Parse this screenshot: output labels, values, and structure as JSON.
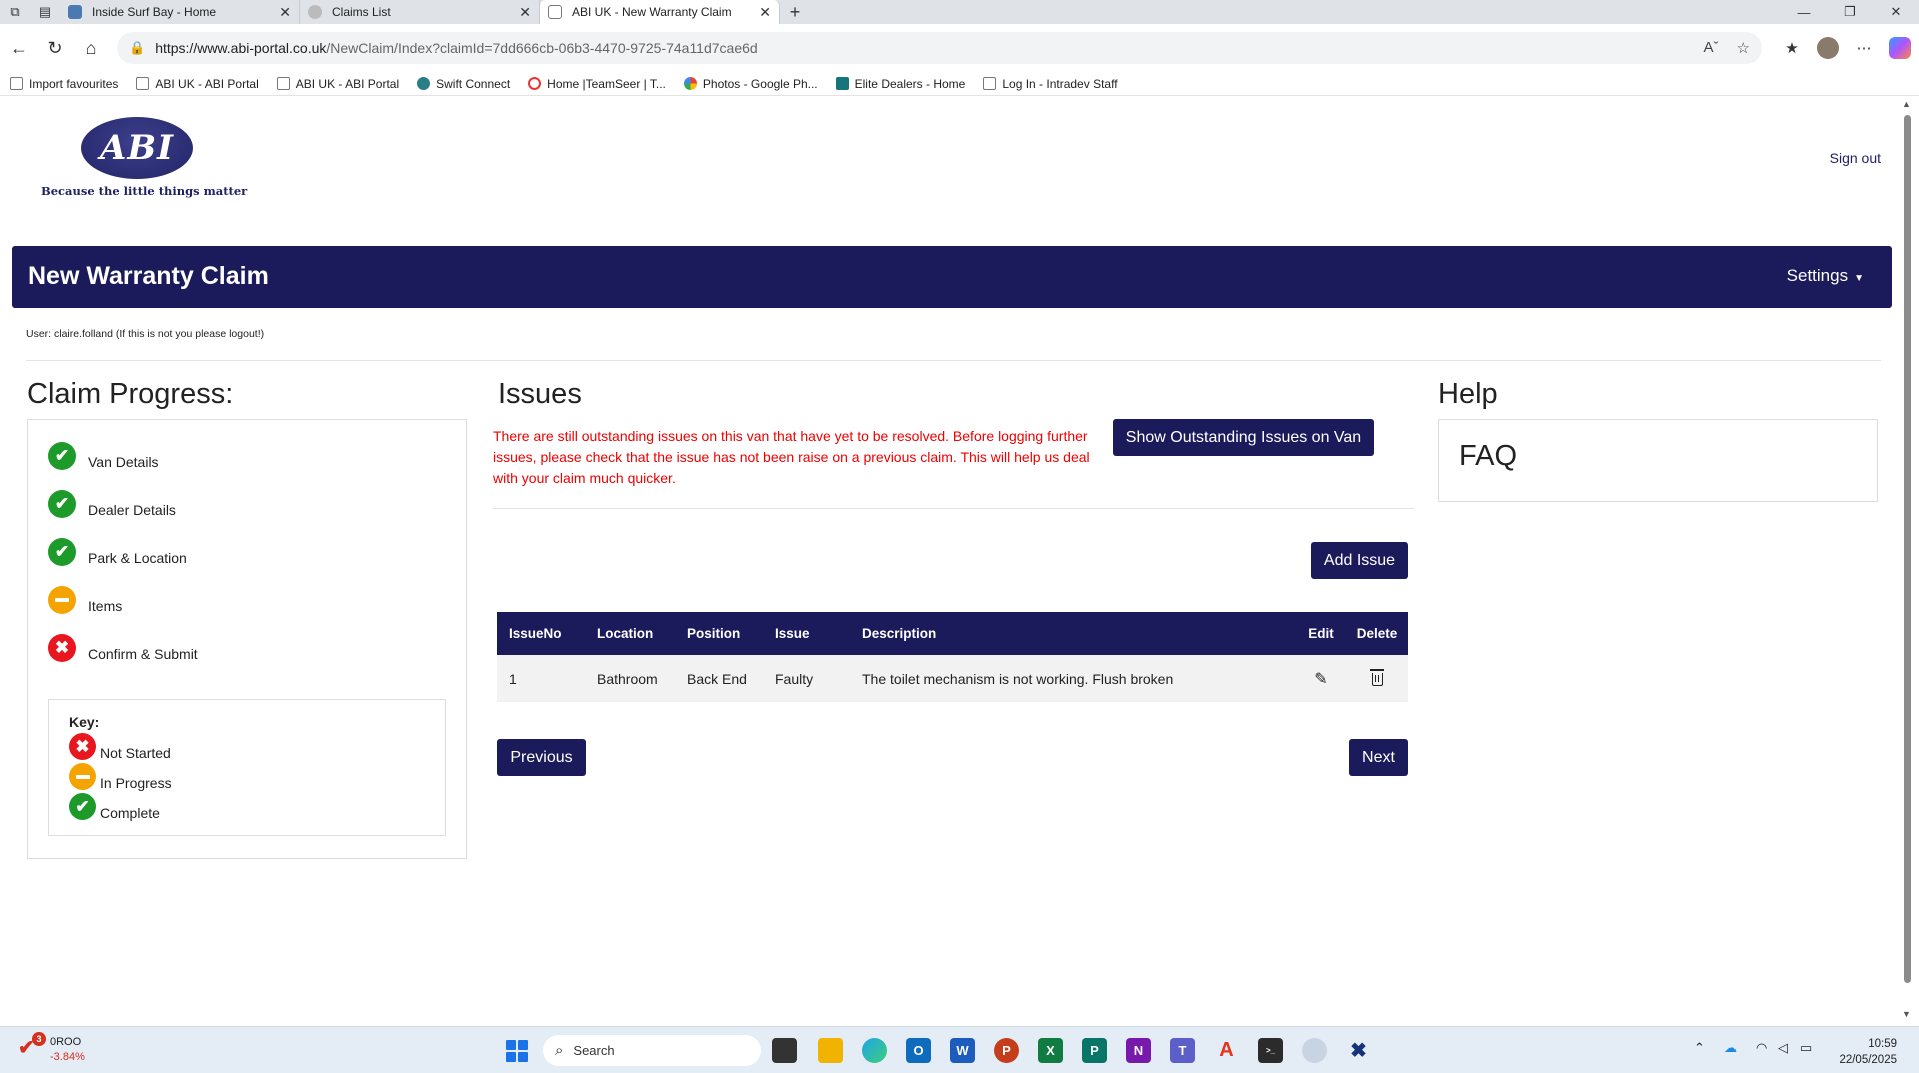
{
  "browser": {
    "tabs": [
      {
        "title": "Inside Surf Bay - Home",
        "active": false
      },
      {
        "title": "Claims List",
        "active": false
      },
      {
        "title": "ABI UK - New Warranty Claim",
        "active": true
      }
    ],
    "url_host": "https://www.abi-portal.co.uk",
    "url_path": "/NewClaim/Index?claimId=7dd666cb-06b3-4470-9725-74a11d7cae6d",
    "bookmarks": [
      "Import favourites",
      "ABI UK - ABI Portal",
      "ABI UK - ABI Portal",
      "Swift Connect",
      "Home |TeamSeer | T...",
      "Photos - Google Ph...",
      "Elite Dealers - Home",
      "Log In - Intradev Staff"
    ]
  },
  "header": {
    "logo_text": "ABI",
    "tagline": "Because the little things matter",
    "sign_out": "Sign out"
  },
  "topbar": {
    "title": "New Warranty Claim",
    "settings": "Settings"
  },
  "user_line": "User: claire.folland (If this is not you please logout!)",
  "progress": {
    "heading": "Claim Progress:",
    "steps": [
      {
        "label": "Van Details",
        "status": "complete"
      },
      {
        "label": "Dealer Details",
        "status": "complete"
      },
      {
        "label": "Park & Location",
        "status": "complete"
      },
      {
        "label": "Items",
        "status": "in-progress"
      },
      {
        "label": "Confirm & Submit",
        "status": "not-started"
      }
    ],
    "key": {
      "title": "Key:",
      "items": [
        {
          "label": "Not Started",
          "status": "not-started"
        },
        {
          "label": "In Progress",
          "status": "in-progress"
        },
        {
          "label": "Complete",
          "status": "complete"
        }
      ]
    }
  },
  "issues": {
    "heading": "Issues",
    "warning": "There are still outstanding issues on this van that have yet to be resolved. Before logging further issues, please check that the issue has not been raise on a previous claim. This will help us deal with your claim much quicker.",
    "show_outstanding_label": "Show Outstanding Issues on Van",
    "add_issue_label": "Add Issue",
    "columns": [
      "IssueNo",
      "Location",
      "Position",
      "Issue",
      "Description",
      "Edit",
      "Delete"
    ],
    "rows": [
      {
        "issue_no": "1",
        "location": "Bathroom",
        "position": "Back End",
        "issue": "Faulty",
        "description": "The toilet mechanism is not working. Flush broken"
      }
    ],
    "previous_label": "Previous",
    "next_label": "Next"
  },
  "help": {
    "heading": "Help",
    "faq": "FAQ"
  },
  "taskbar": {
    "stock_badge": "3",
    "stock_name": "0ROO",
    "stock_change": "-3.84%",
    "search_placeholder": "Search",
    "time": "10:59",
    "date": "22/05/2025"
  },
  "colors": {
    "brand_navy": "#1b1b5c",
    "complete": "#1d9a2a",
    "in_progress": "#f5a300",
    "not_started": "#e8161e",
    "warning_text": "#ee0000"
  }
}
